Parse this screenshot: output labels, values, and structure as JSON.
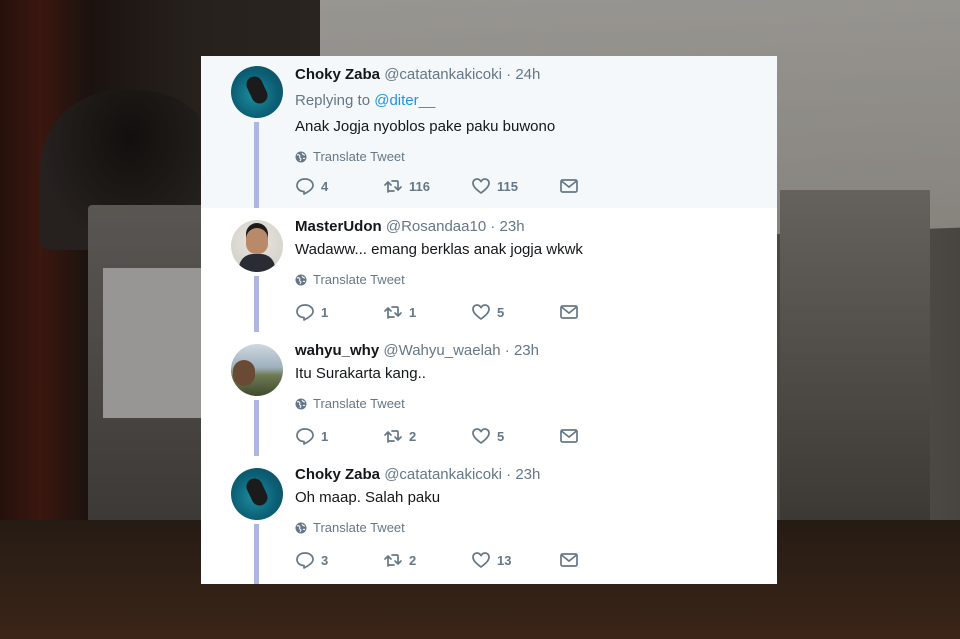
{
  "tweets": [
    {
      "name": "Choky Zaba",
      "handle": "@catatankakicoki",
      "separator": "·",
      "time": "24h",
      "replying_prefix": "Replying to",
      "replying_to": "@diter__",
      "text": "Anak Jogja nyoblos pake paku buwono",
      "translate_label": "Translate Tweet",
      "replies": "4",
      "retweets": "116",
      "likes": "115"
    },
    {
      "name": "MasterUdon",
      "handle": "@Rosandaa10",
      "separator": "·",
      "time": "23h",
      "text": "Wadaww... emang berklas anak jogja wkwk",
      "translate_label": "Translate Tweet",
      "replies": "1",
      "retweets": "1",
      "likes": "5"
    },
    {
      "name": "wahyu_why",
      "handle": "@Wahyu_waelah",
      "separator": "·",
      "time": "23h",
      "text": "Itu Surakarta kang..",
      "translate_label": "Translate Tweet",
      "replies": "1",
      "retweets": "2",
      "likes": "5"
    },
    {
      "name": "Choky Zaba",
      "handle": "@catatankakicoki",
      "separator": "·",
      "time": "23h",
      "text": "Oh maap. Salah paku",
      "translate_label": "Translate Tweet",
      "replies": "3",
      "retweets": "2",
      "likes": "13"
    }
  ],
  "icons": {
    "reply": "reply-icon",
    "retweet": "retweet-icon",
    "like": "heart-icon",
    "dm": "envelope-icon",
    "translate": "globe-icon"
  },
  "colors": {
    "text": "#14171a",
    "secondary": "#657786",
    "link": "#1b95e0",
    "thread_line": "#aeb5e2",
    "highlight_bg": "#f5f8fa"
  }
}
